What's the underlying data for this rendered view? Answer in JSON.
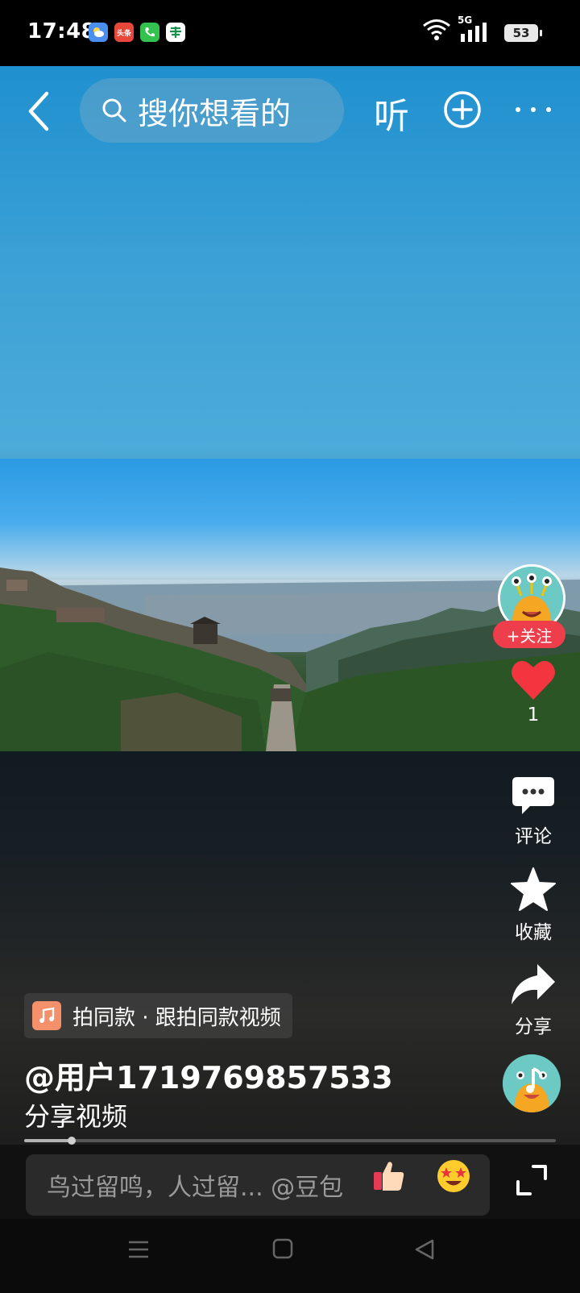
{
  "status_bar": {
    "time": "17:48",
    "network": "5G",
    "battery": "53",
    "app_icons": [
      "weather-icon",
      "toutiao-icon",
      "phone-icon",
      "post-icon"
    ],
    "toutiao_label": "头条"
  },
  "top_nav": {
    "search_placeholder": "搜你想看的",
    "listen_label": "听"
  },
  "rail": {
    "follow_label": "+关注",
    "like_count": "1",
    "comment_label": "评论",
    "favorite_label": "收藏",
    "share_label": "分享"
  },
  "video": {
    "same_style_label": "拍同款 · 跟拍同款视频",
    "author": "@用户1719769857533",
    "description": "分享视频",
    "progress": 0.09
  },
  "comment_bar": {
    "placeholder": "鸟过留鸣，人过留... @豆包"
  },
  "colors": {
    "follow_red": "#ee3e4b",
    "like_red": "#f2353f",
    "sky_blue": "#2a9ae4",
    "avatar_teal": "#6cc9c3",
    "note_orange": "#f4906a"
  }
}
